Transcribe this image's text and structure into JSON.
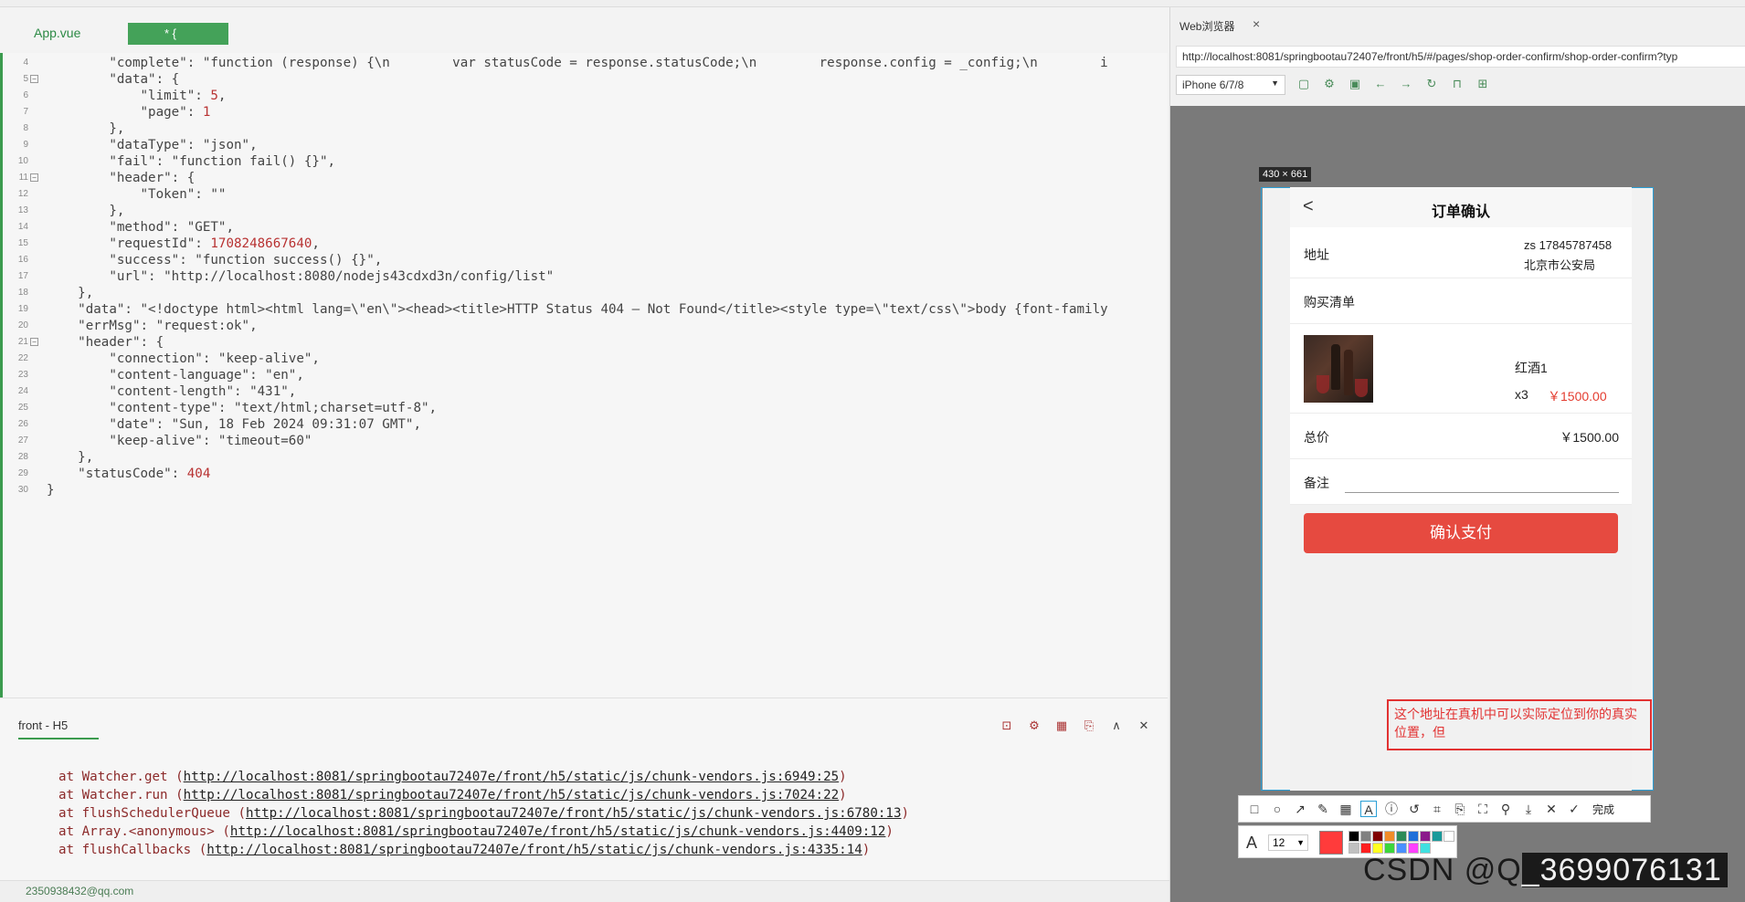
{
  "editor": {
    "tabs": [
      {
        "label": "App.vue"
      },
      {
        "label": "* {"
      }
    ],
    "lines": [
      {
        "n": "4",
        "text": "        \"complete\": \"function (response) {\\n        var statusCode = response.statusCode;\\n        response.config = _config;\\n        i",
        "fold": false
      },
      {
        "n": "5",
        "text": "        \"data\": {",
        "fold": true
      },
      {
        "n": "6",
        "text": "            \"limit\": 5,",
        "fold": false
      },
      {
        "n": "7",
        "text": "            \"page\": 1",
        "fold": false
      },
      {
        "n": "8",
        "text": "        },",
        "fold": false
      },
      {
        "n": "9",
        "text": "        \"dataType\": \"json\",",
        "fold": false
      },
      {
        "n": "10",
        "text": "        \"fail\": \"function fail() {}\",",
        "fold": false
      },
      {
        "n": "11",
        "text": "        \"header\": {",
        "fold": true
      },
      {
        "n": "12",
        "text": "            \"Token\": \"\"",
        "fold": false
      },
      {
        "n": "13",
        "text": "        },",
        "fold": false
      },
      {
        "n": "14",
        "text": "        \"method\": \"GET\",",
        "fold": false
      },
      {
        "n": "15",
        "text": "        \"requestId\": 1708248667640,",
        "fold": false
      },
      {
        "n": "16",
        "text": "        \"success\": \"function success() {}\",",
        "fold": false
      },
      {
        "n": "17",
        "text": "        \"url\": \"http://localhost:8080/nodejs43cdxd3n/config/list\"",
        "fold": false
      },
      {
        "n": "18",
        "text": "    },",
        "fold": false
      },
      {
        "n": "19",
        "text": "    \"data\": \"<!doctype html><html lang=\\\"en\\\"><head><title>HTTP Status 404 – Not Found</title><style type=\\\"text/css\\\">body {font-family",
        "fold": false
      },
      {
        "n": "20",
        "text": "    \"errMsg\": \"request:ok\",",
        "fold": false
      },
      {
        "n": "21",
        "text": "    \"header\": {",
        "fold": true
      },
      {
        "n": "22",
        "text": "        \"connection\": \"keep-alive\",",
        "fold": false
      },
      {
        "n": "23",
        "text": "        \"content-language\": \"en\",",
        "fold": false
      },
      {
        "n": "24",
        "text": "        \"content-length\": \"431\",",
        "fold": false
      },
      {
        "n": "25",
        "text": "        \"content-type\": \"text/html;charset=utf-8\",",
        "fold": false
      },
      {
        "n": "26",
        "text": "        \"date\": \"Sun, 18 Feb 2024 09:31:07 GMT\",",
        "fold": false
      },
      {
        "n": "27",
        "text": "        \"keep-alive\": \"timeout=60\"",
        "fold": false
      },
      {
        "n": "28",
        "text": "    },",
        "fold": false
      },
      {
        "n": "29",
        "text": "    \"statusCode\": 404",
        "fold": false
      },
      {
        "n": "30",
        "text": "}",
        "fold": false
      }
    ]
  },
  "console": {
    "tab_label": "front - H5",
    "logs": [
      {
        "prefix": "at Watcher.get (",
        "link": "http://localhost:8081/springbootau72407e/front/h5/static/js/chunk-vendors.js:6949:25",
        "suffix": ")"
      },
      {
        "prefix": "at Watcher.run (",
        "link": "http://localhost:8081/springbootau72407e/front/h5/static/js/chunk-vendors.js:7024:22",
        "suffix": ")"
      },
      {
        "prefix": "at flushSchedulerQueue (",
        "link": "http://localhost:8081/springbootau72407e/front/h5/static/js/chunk-vendors.js:6780:13",
        "suffix": ")"
      },
      {
        "prefix": "at Array.<anonymous> (",
        "link": "http://localhost:8081/springbootau72407e/front/h5/static/js/chunk-vendors.js:4409:12",
        "suffix": ")"
      },
      {
        "prefix": "at flushCallbacks (",
        "link": "http://localhost:8081/springbootau72407e/front/h5/static/js/chunk-vendors.js:4335:14",
        "suffix": ")"
      }
    ]
  },
  "statusbar": {
    "email": "2350938432@qq.com"
  },
  "browser": {
    "tab_label": "Web浏览器",
    "close": "×",
    "url": "http://localhost:8081/springbootau72407e/front/h5/#/pages/shop-order-confirm/shop-order-confirm?typ",
    "device": "iPhone 6/7/8",
    "viewport_size": "430 × 661"
  },
  "page": {
    "title": "订单确认",
    "back": "<",
    "address_label": "地址",
    "address_name": "zs 17845787458",
    "address_city": "北京市公安局",
    "list_label": "购买清单",
    "product_name": "红酒1",
    "product_qty": "x3",
    "product_price": "￥1500.00",
    "total_label": "总价",
    "total_value": "￥1500.00",
    "remark_label": "备注",
    "pay_button": "确认支付"
  },
  "annotation": {
    "text": "这个地址在真机中可以实际定位到你的真实位置，但"
  },
  "capture": {
    "done_label": "完成",
    "font_size": "12",
    "current_color": "#ff3b3b",
    "palette": [
      "#000000",
      "#808080",
      "#800000",
      "#f28c28",
      "#2e8b57",
      "#1e6fd9",
      "#8b1a8b",
      "#1a9a9a",
      "#ffffff",
      "#c0c0c0",
      "#ff2020",
      "#ffff20",
      "#3cd63c",
      "#4a90ff",
      "#ff40ff",
      "#40e0e0"
    ]
  },
  "watermark": {
    "text1": "CSDN @Q",
    "text2": "_3699076131"
  }
}
